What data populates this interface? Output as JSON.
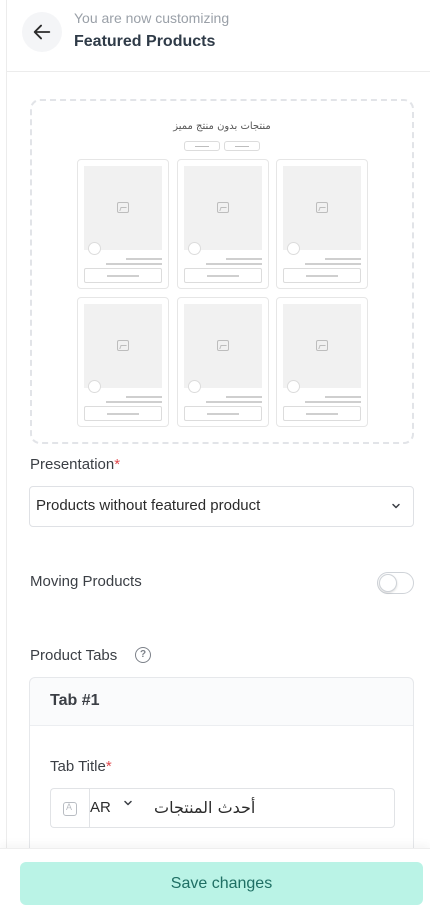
{
  "header": {
    "subtitle": "You are now customizing",
    "title": "Featured Products"
  },
  "preview": {
    "title": "منتجات بدون منتج مميز",
    "card_count": 6
  },
  "presentation": {
    "label": "Presentation",
    "required_mark": "*",
    "selected": "Products without featured product"
  },
  "moving_products": {
    "label": "Moving Products",
    "enabled": false
  },
  "product_tabs": {
    "label": "Product Tabs",
    "help_glyph": "?",
    "tab": {
      "heading": "Tab #1",
      "title_label": "Tab Title",
      "required_mark": "*",
      "language": "AR",
      "value": "أحدث المنتجات"
    }
  },
  "footer": {
    "save_label": "Save changes"
  },
  "colors": {
    "save_bg": "#baf3e6",
    "save_text": "#1f6f64",
    "required": "#e0484d"
  }
}
